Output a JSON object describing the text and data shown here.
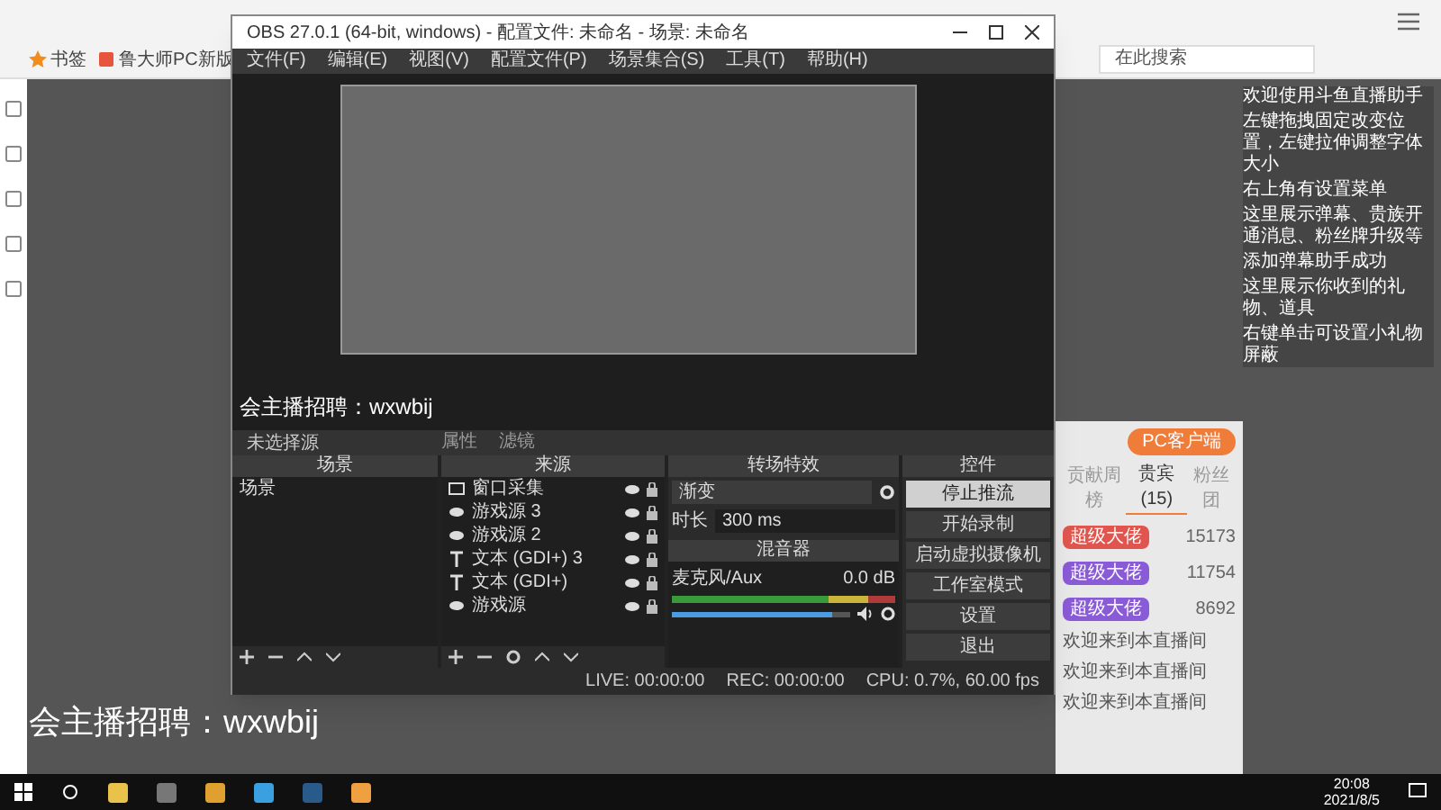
{
  "browser": {
    "search_placeholder": "在此搜索",
    "bookmarks": [
      "书签",
      "鲁大师PC新版"
    ]
  },
  "stream_chat": [
    "欢迎使用斗鱼直播助手",
    "左键拖拽固定改变位置，左键拉伸调整字体大小",
    "右上角有设置菜单",
    "这里展示弹幕、贵族开通消息、粉丝牌升级等",
    "添加弹幕助手成功",
    "这里展示你收到的礼物、道具",
    "右键单击可设置小礼物屏蔽"
  ],
  "client_button": "PC客户端",
  "rank_tabs": [
    {
      "label": "贡献周榜",
      "selected": false
    },
    {
      "label": "贵宾(15)",
      "selected": true
    },
    {
      "label": "粉丝团",
      "selected": false
    }
  ],
  "rank_rows": [
    {
      "badge": "超级大佬",
      "score": "15173",
      "color": "#e0564f"
    },
    {
      "badge": "超级大佬",
      "score": "11754",
      "color": "#8a5bd6"
    },
    {
      "badge": "超级大佬",
      "score": "8692",
      "color": "#8a5bd6"
    }
  ],
  "chat_lines": [
    "欢迎来到本直播间",
    "欢迎来到本直播间",
    "欢迎来到本直播间"
  ],
  "obs": {
    "title": "OBS 27.0.1 (64-bit, windows) - 配置文件: 未命名 - 场景: 未命名",
    "menu": [
      "文件(F)",
      "编辑(E)",
      "视图(V)",
      "配置文件(P)",
      "场景集合(S)",
      "工具(T)",
      "帮助(H)"
    ],
    "preview_overlay": "会主播招聘：wxwbij",
    "selection_label": "未选择源",
    "context_tabs": [
      "属性",
      "滤镜"
    ],
    "scenes": {
      "title": "场景",
      "items": [
        {
          "label": "场景",
          "selected": false
        }
      ]
    },
    "sources": {
      "title": "来源",
      "items": [
        {
          "kind": "window",
          "label": "窗口采集"
        },
        {
          "kind": "game",
          "label": "游戏源 3"
        },
        {
          "kind": "game",
          "label": "游戏源 2"
        },
        {
          "kind": "text",
          "label": "文本 (GDI+) 3"
        },
        {
          "kind": "text",
          "label": "文本 (GDI+)"
        },
        {
          "kind": "game",
          "label": "游戏源"
        }
      ]
    },
    "transitions": {
      "title": "转场特效",
      "type": "渐变",
      "duration_label": "时长",
      "duration": "300 ms"
    },
    "mixer": {
      "title": "混音器",
      "channel": "麦克风/Aux",
      "reading": "0.0 dB",
      "level": 0.9
    },
    "controls": {
      "title": "控件",
      "buttons": [
        {
          "label": "停止推流",
          "selected": true
        },
        {
          "label": "开始录制",
          "selected": false
        },
        {
          "label": "启动虚拟摄像机",
          "selected": false
        },
        {
          "label": "工作室模式",
          "selected": false
        },
        {
          "label": "设置",
          "selected": false
        },
        {
          "label": "退出",
          "selected": false
        }
      ]
    },
    "status": {
      "live": "LIVE: 00:00:00",
      "rec": "REC: 00:00:00",
      "cpu": "CPU: 0.7%, 60.00 fps"
    }
  },
  "overlay_text": "会主播招聘：wxwbij",
  "taskbar": {
    "time": "20:08",
    "date": "2021/8/5"
  }
}
